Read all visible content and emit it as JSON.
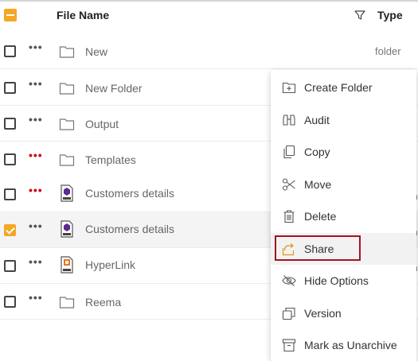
{
  "header": {
    "file_name": "File Name",
    "type": "Type"
  },
  "rows": [
    {
      "name": "New",
      "type": "folder",
      "icon": "folder-icon",
      "dots_red": false,
      "checked": false
    },
    {
      "name": "New Folder",
      "icon": "folder-icon",
      "dots_red": false,
      "checked": false
    },
    {
      "name": "Output",
      "icon": "folder-icon",
      "dots_red": false,
      "checked": false
    },
    {
      "name": "Templates",
      "icon": "folder-icon",
      "dots_red": true,
      "checked": false
    },
    {
      "name": "Customers details",
      "icon": "birt-file-icon",
      "dots_red": true,
      "checked": false,
      "edge": "n"
    },
    {
      "name": "Customers details",
      "icon": "birt-file-icon",
      "dots_red": false,
      "checked": true,
      "edge": "n"
    },
    {
      "name": "HyperLink",
      "icon": "rudc-file-icon",
      "dots_red": false,
      "checked": false,
      "edge": "n"
    },
    {
      "name": "Reema",
      "icon": "folder-icon",
      "dots_red": false,
      "checked": false
    }
  ],
  "menu": {
    "items": [
      {
        "label": "Create Folder",
        "icon": "create-folder-icon"
      },
      {
        "label": "Audit",
        "icon": "binoculars-icon"
      },
      {
        "label": "Copy",
        "icon": "copy-icon"
      },
      {
        "label": "Move",
        "icon": "scissors-icon"
      },
      {
        "label": "Delete",
        "icon": "trash-icon"
      },
      {
        "label": "Share",
        "icon": "share-icon"
      },
      {
        "label": "Hide Options",
        "icon": "eye-slash-icon"
      },
      {
        "label": "Version",
        "icon": "version-icon"
      },
      {
        "label": "Mark as Unarchive",
        "icon": "unarchive-icon"
      }
    ]
  },
  "colors": {
    "accent": "#f5a623",
    "highlight_border": "#a2141f",
    "red_dots": "#d0021b"
  }
}
